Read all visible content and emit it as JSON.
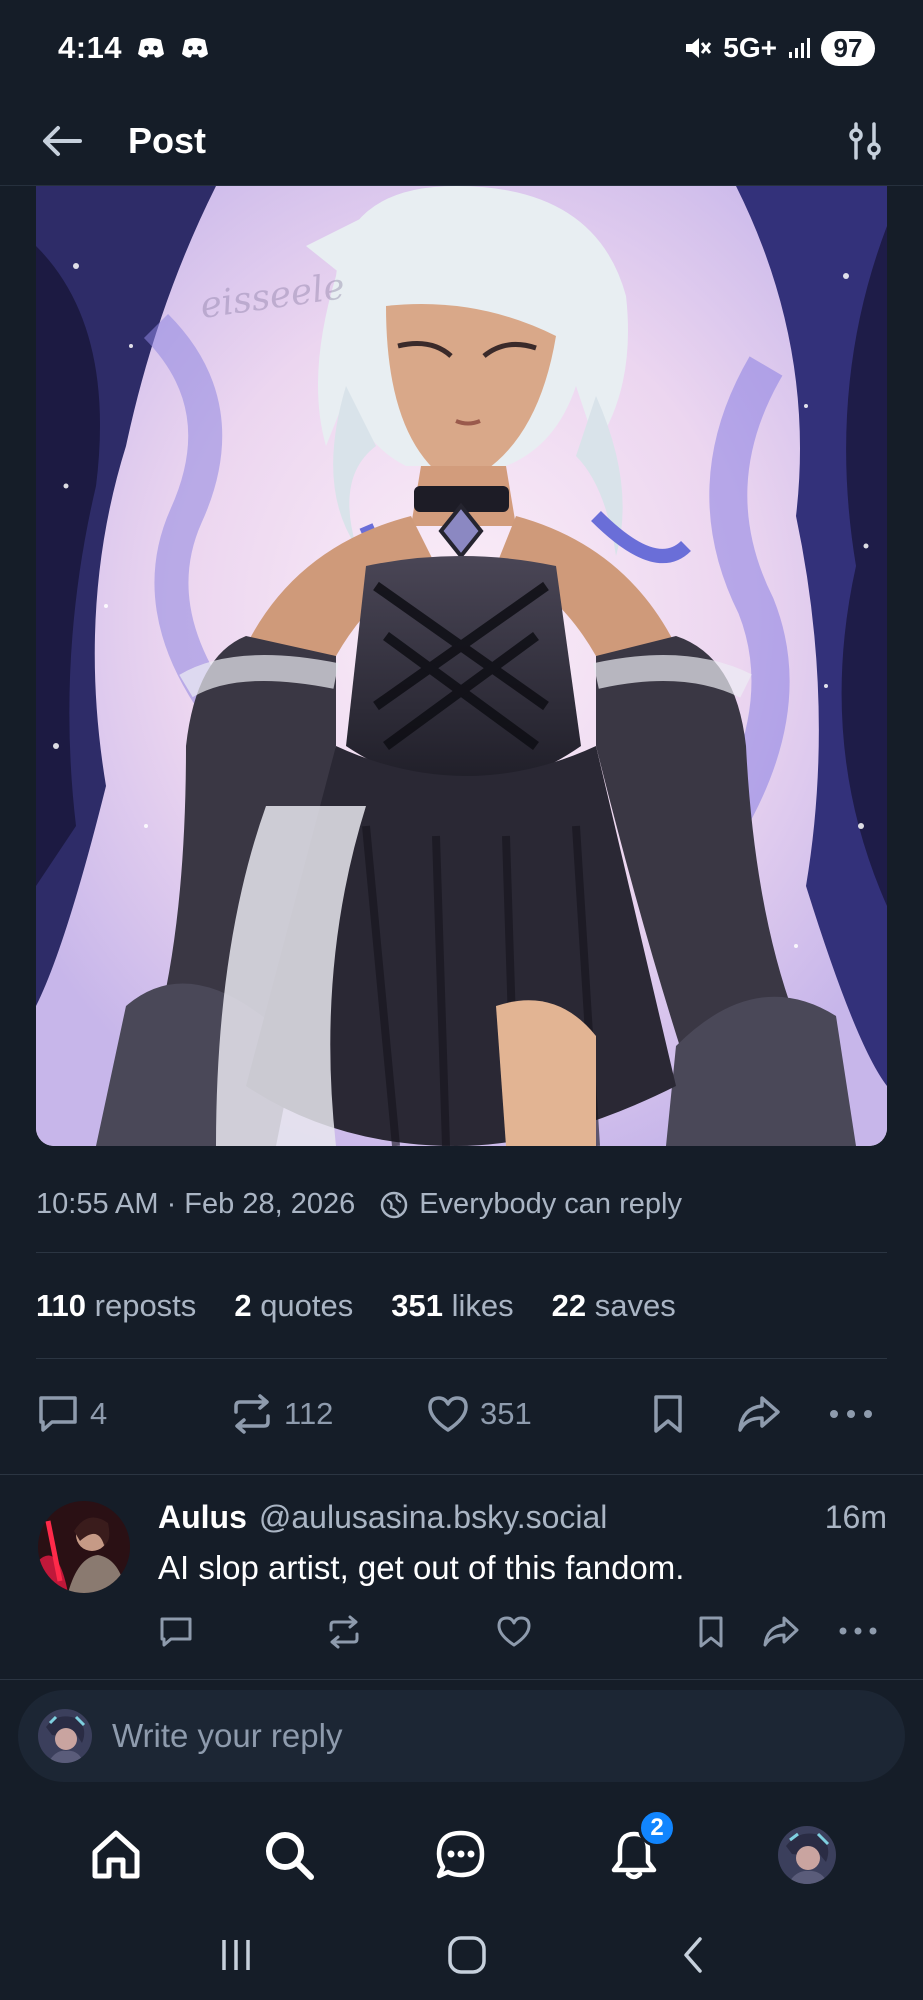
{
  "status_bar": {
    "time": "4:14",
    "network": "5G+",
    "battery": "97"
  },
  "header": {
    "title": "Post"
  },
  "post": {
    "image_watermark": "eisseele",
    "timestamp": "10:55 AM · Feb 28, 2026",
    "reply_setting": "Everybody can reply",
    "stats": {
      "reposts_count": "110",
      "reposts_label": "reposts",
      "quotes_count": "2",
      "quotes_label": "quotes",
      "likes_count": "351",
      "likes_label": "likes",
      "saves_count": "22",
      "saves_label": "saves"
    },
    "actions": {
      "replies": "4",
      "reposts": "112",
      "likes": "351"
    }
  },
  "reply": {
    "author": "Aulus",
    "handle": "@aulusasina.bsky.social",
    "time": "16m",
    "text": "AI slop artist, get out of this fandom."
  },
  "composer": {
    "placeholder": "Write your reply"
  },
  "tab_bar": {
    "notifications_badge": "2"
  },
  "colors": {
    "background": "#151d28",
    "accent": "#1185fe",
    "muted_text": "#aab5c4"
  }
}
